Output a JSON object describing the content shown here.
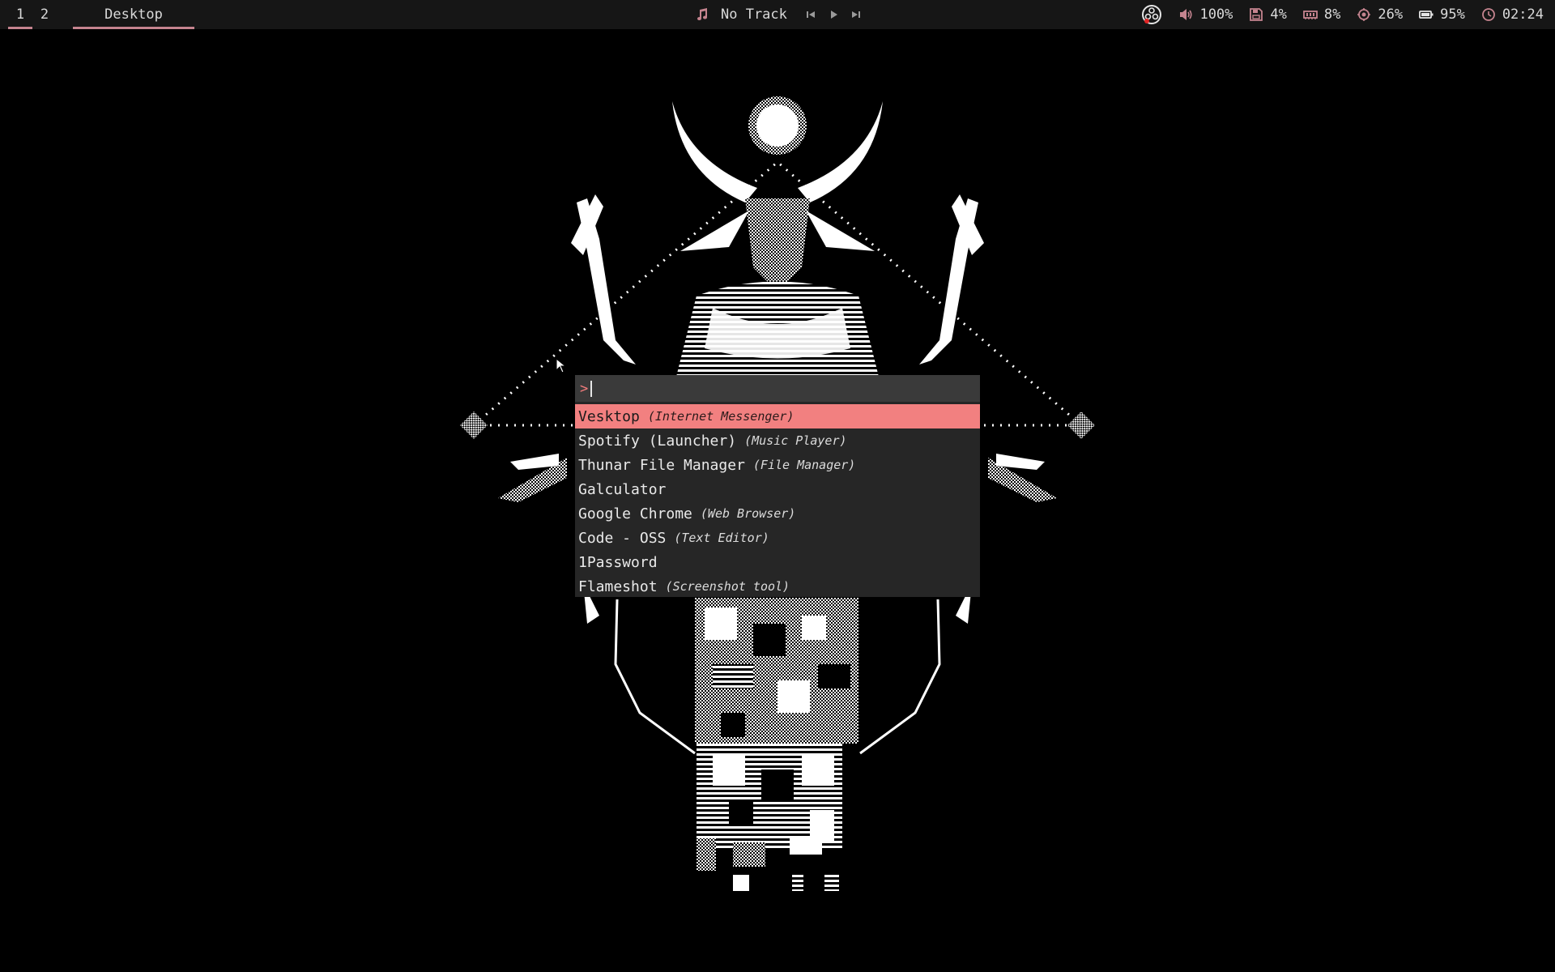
{
  "workspaces": [
    {
      "label": "1",
      "active": true
    },
    {
      "label": "2",
      "active": false
    }
  ],
  "window_title": "Desktop",
  "media": {
    "icon": "music-note-icon",
    "track": "No Track",
    "controls": [
      "previous-icon",
      "play-icon",
      "next-icon"
    ]
  },
  "status": {
    "tray_icon": "obs-icon",
    "volume": {
      "icon": "speaker-icon",
      "value": "100%"
    },
    "disk": {
      "icon": "disk-icon",
      "value": "4%"
    },
    "memory": {
      "icon": "memory-icon",
      "value": "8%"
    },
    "cpu": {
      "icon": "cpu-icon",
      "value": "26%"
    },
    "battery": {
      "icon": "battery-icon",
      "value": "95%"
    },
    "clock": {
      "icon": "clock-icon",
      "value": "02:24"
    }
  },
  "launcher": {
    "prompt": ">",
    "query": "",
    "entries": [
      {
        "name": "Vesktop",
        "desc": "(Internet Messenger)"
      },
      {
        "name": "Spotify (Launcher)",
        "desc": "(Music Player)"
      },
      {
        "name": "Thunar File Manager",
        "desc": "(File Manager)"
      },
      {
        "name": "Galculator",
        "desc": ""
      },
      {
        "name": "Google Chrome",
        "desc": "(Web Browser)"
      },
      {
        "name": "Code - OSS",
        "desc": "(Text Editor)"
      },
      {
        "name": "1Password",
        "desc": ""
      },
      {
        "name": "Flameshot",
        "desc": "(Screenshot tool)"
      }
    ],
    "selected_index": 0
  },
  "colors": {
    "accent": "#f28080",
    "bar_bg": "#161616",
    "launcher_bg": "#262626",
    "prompt_bg": "#3a3a3a",
    "icon_pink": "#c5848f"
  }
}
